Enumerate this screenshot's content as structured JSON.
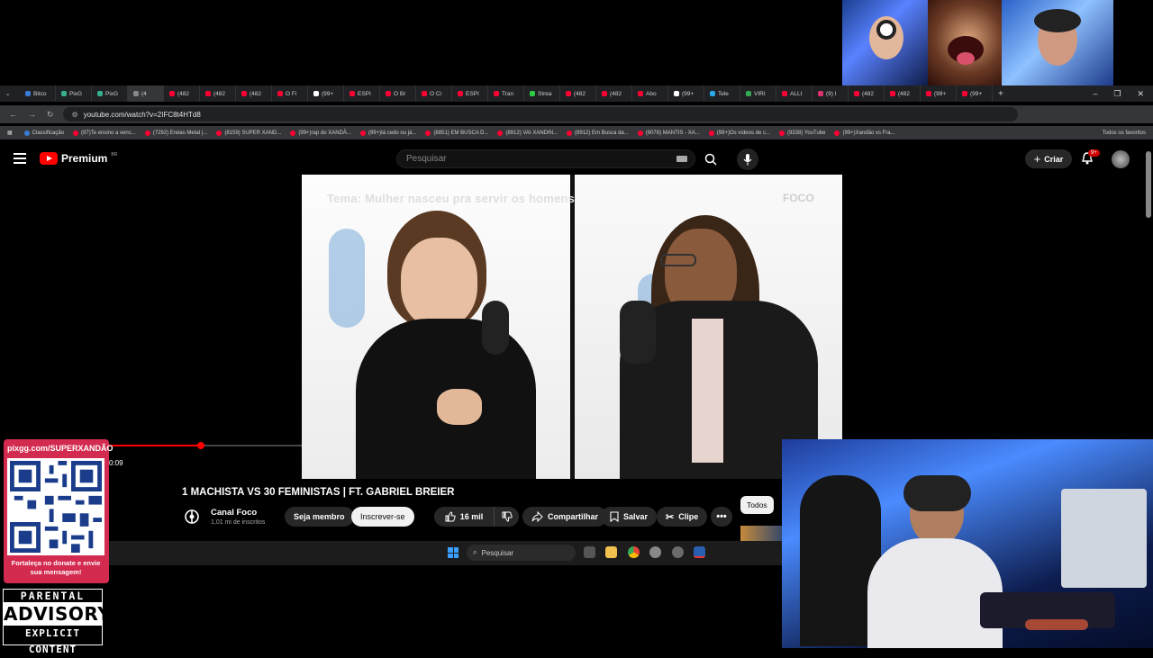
{
  "browser": {
    "tabs": [
      "Bitco",
      "PixG",
      "PixG",
      "(4",
      "(482",
      "(482",
      "(482",
      "O Fi",
      "(99+",
      "ESPI",
      "O Br",
      "O Ci",
      "ESPI",
      "Tran",
      "Strea",
      "(482",
      "(482",
      "Abo",
      "(99+",
      "Tele",
      "VIRI",
      "ALLI",
      "(9) I",
      "(482",
      "(482",
      "(99+",
      "(99+"
    ],
    "url": "youtube.com/watch?v=2IFC8t4HTd8",
    "bookmarks": [
      "Classificação",
      "(97)Te ensino a venc...",
      "(7292) Erelas Metal |...",
      "(8159) SUPER XAND...",
      "(99+)rap do XANDÃ...",
      "(99+)tá cedo ou já...",
      "(8851) EM BUSCA D...",
      "(8912) VAI XANDIN...",
      "(8912) Em Busca da...",
      "(9078) MANTIS - XA...",
      "(99+)Os vídeos de c...",
      "(9338) YouTube",
      "(99+)Xandão vs Fra..."
    ],
    "all_favorites": "Todos os favoritos"
  },
  "youtube": {
    "logo_text": "Premium",
    "logo_region": "BR",
    "search_placeholder": "Pesquisar",
    "create_label": "Criar",
    "notification_badge": "9+",
    "video": {
      "overlay_title": "Tema: Mulher nasceu pra servir os homens",
      "watermark": "FOCO",
      "time": "0:09",
      "progress": 0.48
    },
    "title": "1 MACHISTA VS 30 FEMINISTAS | FT. GABRIEL BREIER",
    "channel_name": "Canal Foco",
    "subscribers": "1,01 mi de inscritos",
    "member_label": "Seja membro",
    "subscribe_label": "Inscrever-se",
    "likes": "16 mil",
    "share_label": "Compartilhar",
    "save_label": "Salvar",
    "clip_label": "Clipe",
    "filter_chip": "Todos"
  },
  "taskbar": {
    "search_placeholder": "Pesquisar"
  },
  "overlay": {
    "donate_url": "pixgg.com/SUPERXANDÃO",
    "donate_message": "Fortaleça no donate e envie sua mensagem!",
    "advisory_line1": "PARENTAL",
    "advisory_line2": "ADVISORY",
    "advisory_line3": "EXPLICIT CONTENT"
  },
  "colors": {
    "youtube_red": "#ff0000",
    "donate_bg": "#d32a4f",
    "browser_dark": "#202124"
  }
}
